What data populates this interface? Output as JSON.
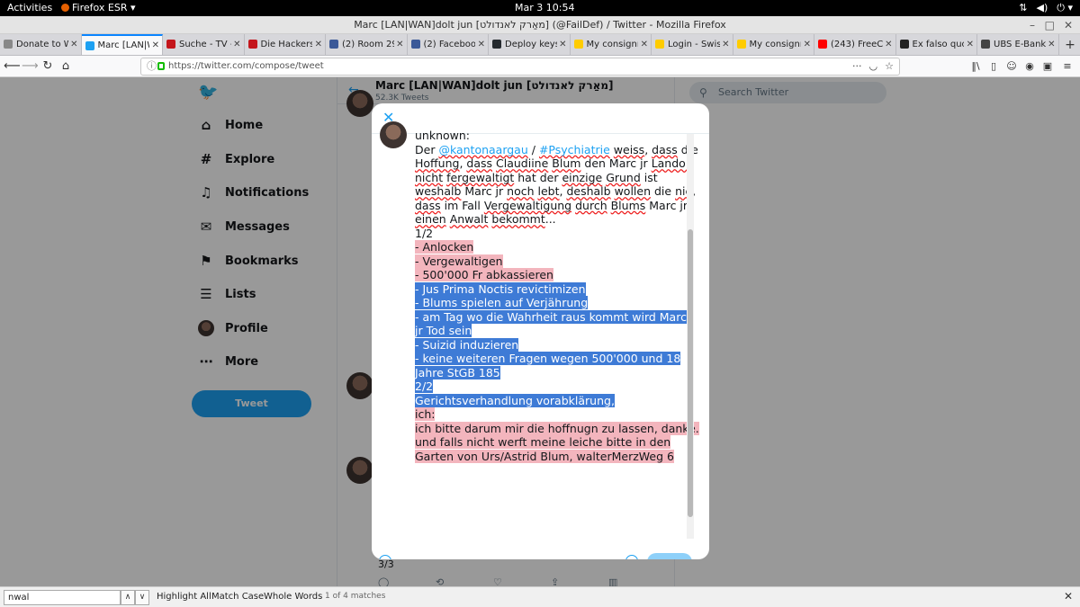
{
  "topbar": {
    "activities": "Activities",
    "app_menu": "Firefox ESR ▾",
    "clock": "Mar 3  10:54",
    "network_icon": "network-icon",
    "volume_icon": "volume-icon",
    "power_icon": "power-icon"
  },
  "window": {
    "title": "Marc [LAN|WAN]dolt jun [מאַרק לאנדולט] (@FailDef) / Twitter - Mozilla Firefox"
  },
  "tabs": [
    {
      "label": "Donate to W",
      "favicon_color": "#888888"
    },
    {
      "label": "Marc [LAN|W",
      "favicon_color": "#1da1f2",
      "active": true
    },
    {
      "label": "Suche - TV -",
      "favicon_color": "#c4161c"
    },
    {
      "label": "Die Hackers",
      "favicon_color": "#c4161c"
    },
    {
      "label": "(2) Room 29",
      "favicon_color": "#3b5998"
    },
    {
      "label": "(2) Facebook",
      "favicon_color": "#3b5998"
    },
    {
      "label": "Deploy keys",
      "favicon_color": "#24292e"
    },
    {
      "label": "My consignm",
      "favicon_color": "#ffcc00"
    },
    {
      "label": "Login - Swis",
      "favicon_color": "#ffcc00"
    },
    {
      "label": "My consignm",
      "favicon_color": "#ffcc00"
    },
    {
      "label": "(243) FreeCA",
      "favicon_color": "#ff0000"
    },
    {
      "label": "Ex falso quo",
      "favicon_color": "#222222"
    },
    {
      "label": "UBS E-Bank",
      "favicon_color": "#444444"
    }
  ],
  "url": "https://twitter.com/compose/tweet",
  "sidebar": {
    "items": [
      {
        "label": "Home",
        "icon": "home-icon",
        "glyph": "⌂"
      },
      {
        "label": "Explore",
        "icon": "hashtag-icon",
        "glyph": "#"
      },
      {
        "label": "Notifications",
        "icon": "bell-icon",
        "glyph": "♫"
      },
      {
        "label": "Messages",
        "icon": "envelope-icon",
        "glyph": "✉"
      },
      {
        "label": "Bookmarks",
        "icon": "bookmark-icon",
        "glyph": "⚑"
      },
      {
        "label": "Lists",
        "icon": "list-icon",
        "glyph": "☰"
      },
      {
        "label": "Profile",
        "icon": "avatar",
        "glyph": ""
      },
      {
        "label": "More",
        "icon": "more-icon",
        "glyph": "⋯"
      }
    ],
    "tweet_button": "Tweet"
  },
  "profile_header": {
    "name": "Marc [LAN|WAN]dolt jun [מאַרק לאנדולט]",
    "tweet_count": "52.3K Tweets"
  },
  "search_placeholder": "Search Twitter",
  "thread_counter": "3/3",
  "modal": {
    "lines": [
      [
        {
          "t": "unknown:"
        }
      ],
      [
        {
          "t": " "
        }
      ],
      [
        {
          "t": "Der "
        },
        {
          "t": "@kantonaargau",
          "c": "mention sq"
        },
        {
          "t": " / "
        },
        {
          "t": "#Psychiatrie",
          "c": "mention sq"
        },
        {
          "t": " "
        },
        {
          "t": "weiss",
          "c": "sq"
        },
        {
          "t": ", "
        },
        {
          "t": "dass",
          "c": "sq"
        },
        {
          "t": " die"
        }
      ],
      [
        {
          "t": "Hoffung",
          "c": "sq"
        },
        {
          "t": ", "
        },
        {
          "t": "dass",
          "c": "sq"
        },
        {
          "t": " "
        },
        {
          "t": "Claudiine",
          "c": "sq"
        },
        {
          "t": " "
        },
        {
          "t": "Blum",
          "c": "sq"
        },
        {
          "t": " den Marc jr "
        },
        {
          "t": "Landolt",
          "c": "sq"
        }
      ],
      [
        {
          "t": "nicht",
          "c": "sq"
        },
        {
          "t": " "
        },
        {
          "t": "fergewaltigt",
          "c": "sq"
        },
        {
          "t": " hat der "
        },
        {
          "t": "einzige",
          "c": "sq"
        },
        {
          "t": " "
        },
        {
          "t": "Grund",
          "c": "sq"
        },
        {
          "t": " ist"
        }
      ],
      [
        {
          "t": "weshalb",
          "c": "sq"
        },
        {
          "t": " Marc jr "
        },
        {
          "t": "noch",
          "c": "sq"
        },
        {
          "t": " "
        },
        {
          "t": "lebt",
          "c": "sq"
        },
        {
          "t": ", "
        },
        {
          "t": "deshalb",
          "c": "sq"
        },
        {
          "t": " "
        },
        {
          "t": "wollen",
          "c": "sq"
        },
        {
          "t": " die "
        },
        {
          "t": "nie",
          "c": "sq"
        },
        {
          "t": ","
        }
      ],
      [
        {
          "t": "dass",
          "c": "sq"
        },
        {
          "t": " im Fall "
        },
        {
          "t": "Vergewaltigung",
          "c": "sq"
        },
        {
          "t": " "
        },
        {
          "t": "durch",
          "c": "sq"
        },
        {
          "t": " "
        },
        {
          "t": "Blums",
          "c": "sq"
        },
        {
          "t": " Marc jr"
        }
      ],
      [
        {
          "t": "einen",
          "c": "sq"
        },
        {
          "t": " "
        },
        {
          "t": "Anwalt",
          "c": "sq"
        },
        {
          "t": " "
        },
        {
          "t": "bekommt",
          "c": "sq"
        },
        {
          "t": "..."
        }
      ],
      [
        {
          "t": "1/2"
        }
      ],
      [
        {
          "t": "- Anlocken",
          "c": "hp"
        }
      ],
      [
        {
          "t": "- Vergewaltigen",
          "c": "hp"
        }
      ],
      [
        {
          "t": "- 500'000 Fr abkassieren",
          "c": "hp"
        }
      ],
      [
        {
          "t": "- Jus Prima Noctis revictimizen",
          "c": "hb"
        }
      ],
      [
        {
          "t": "- Blums spielen auf Verjährung",
          "c": "hb"
        }
      ],
      [
        {
          "t": "- am Tag wo die Wahrheit raus kommt wird Marc",
          "c": "hb"
        }
      ],
      [
        {
          "t": "jr Tod sein",
          "c": "hb"
        }
      ],
      [
        {
          "t": "- Suizid induzieren",
          "c": "hb"
        }
      ],
      [
        {
          "t": "- keine weiteren Fragen wegen 500'000 und 18",
          "c": "hb"
        }
      ],
      [
        {
          "t": "Jahre StGB 185",
          "c": "hb"
        }
      ],
      [
        {
          "t": "2/2",
          "c": "hb"
        }
      ],
      [
        {
          "t": " "
        }
      ],
      [
        {
          "t": "Gerichtsverhandlung vorabklärung,",
          "c": "hb"
        }
      ],
      [
        {
          "t": " "
        }
      ],
      [
        {
          "t": "ich:",
          "c": "hp"
        }
      ],
      [
        {
          "t": "ich bitte darum mir die hoffnugn zu lassen, danke.",
          "c": "hp"
        }
      ],
      [
        {
          "t": "und falls nicht werft meine leiche bitte in den",
          "c": "hp"
        }
      ],
      [
        {
          "t": "Garten von Urs/Astrid Blum, walterMerzWeg 6",
          "c": "hp"
        }
      ]
    ]
  },
  "findbar": {
    "value": "nwal",
    "highlight_all": "Highlight All",
    "match_case": "Match Case",
    "whole_words": "Whole Words",
    "status": "1 of 4 matches"
  }
}
